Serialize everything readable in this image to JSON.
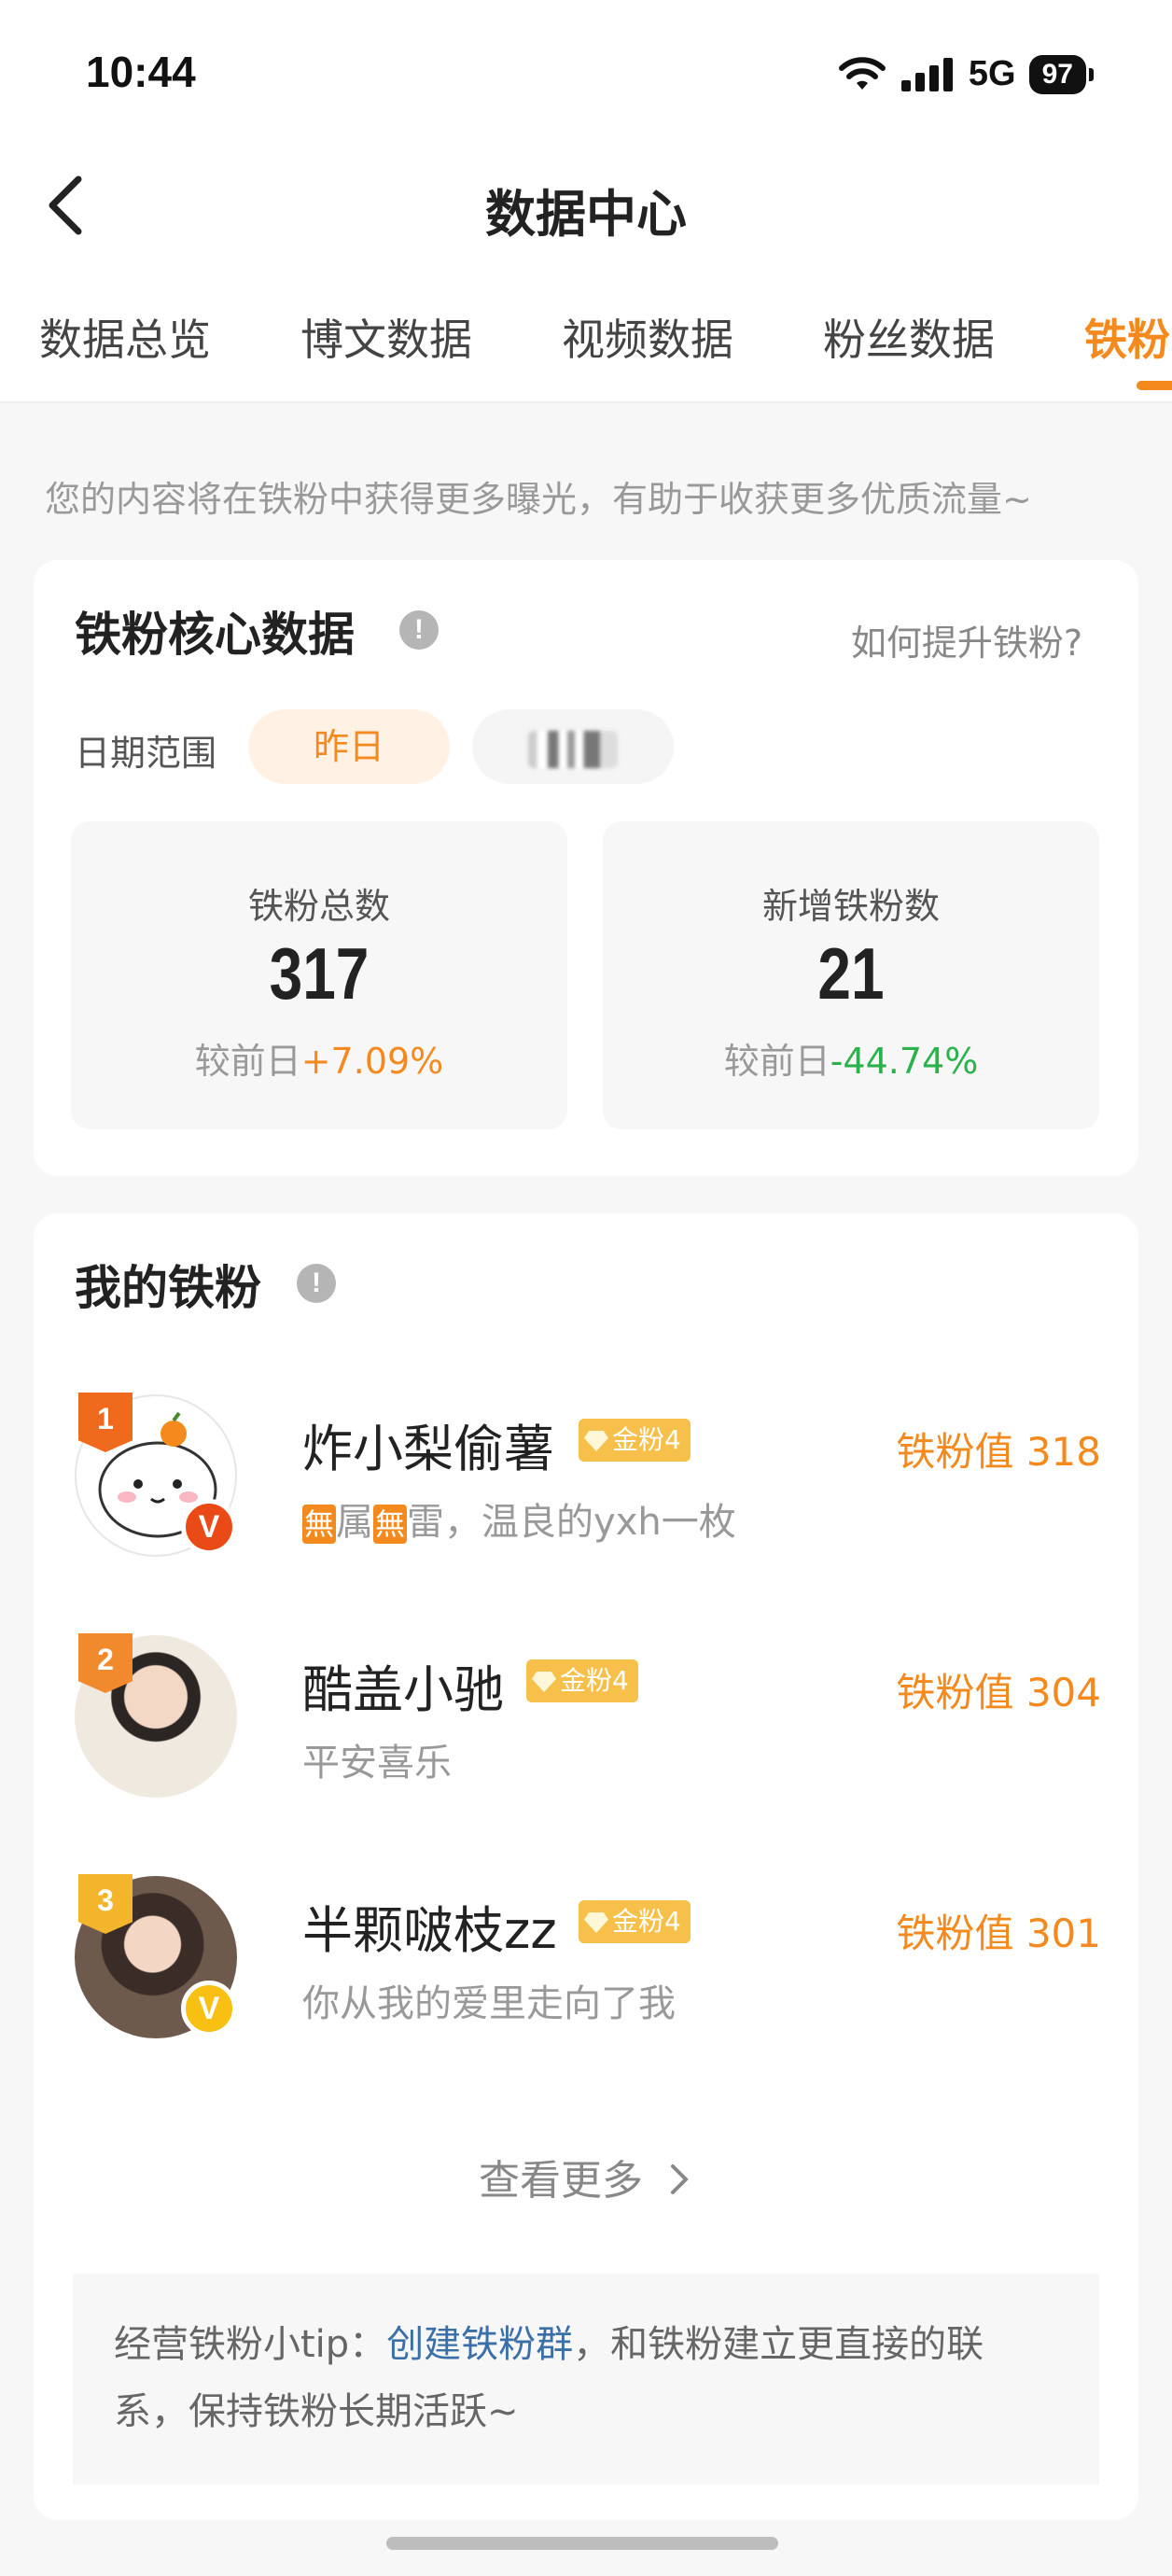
{
  "status_bar": {
    "time": "10:44",
    "network": "5G",
    "battery": "97"
  },
  "nav": {
    "title": "数据中心"
  },
  "tabs": [
    {
      "label": "数据总览",
      "active": false
    },
    {
      "label": "博文数据",
      "active": false
    },
    {
      "label": "视频数据",
      "active": false
    },
    {
      "label": "粉丝数据",
      "active": false
    },
    {
      "label": "铁粉",
      "active": true
    }
  ],
  "hint": "您的内容将在铁粉中获得更多曝光，有助于收获更多优质流量~",
  "core": {
    "title": "铁粉核心数据",
    "help_link": "如何提升铁粉?",
    "date_label": "日期范围",
    "date_active": "昨日",
    "stats": [
      {
        "label": "铁粉总数",
        "value": "317",
        "change_prefix": "较前日",
        "change": "+7.09%"
      },
      {
        "label": "新增铁粉数",
        "value": "21",
        "change_prefix": "较前日",
        "change": "-44.74%"
      }
    ]
  },
  "my_fans": {
    "title": "我的铁粉",
    "badge_label": "金粉4",
    "fans": [
      {
        "rank": "1",
        "name": "炸小梨偷薯",
        "badge": "金粉4",
        "score": "铁粉值 318",
        "desc_prefix1": "無",
        "desc_text1": "属",
        "desc_prefix2": "無",
        "desc_text2": "雷，温良的yxh一枚",
        "verified": true
      },
      {
        "rank": "2",
        "name": "酷盖小驰",
        "badge": "金粉4",
        "score": "铁粉值 304",
        "desc": "平安喜乐",
        "verified": false
      },
      {
        "rank": "3",
        "name": "半颗啵枝zz",
        "badge": "金粉4",
        "score": "铁粉值 301",
        "desc": "你从我的爱里走向了我",
        "verified": true
      }
    ],
    "more": "查看更多",
    "tip_prefix": "经营铁粉小tip：",
    "tip_link": "创建铁粉群",
    "tip_suffix": "，和铁粉建立更直接的联系，保持铁粉长期活跃~"
  },
  "colors": {
    "accent": "#f48a1e",
    "positive": "#f48a1e",
    "negative": "#2bb24c",
    "link": "#3b6fa8"
  }
}
